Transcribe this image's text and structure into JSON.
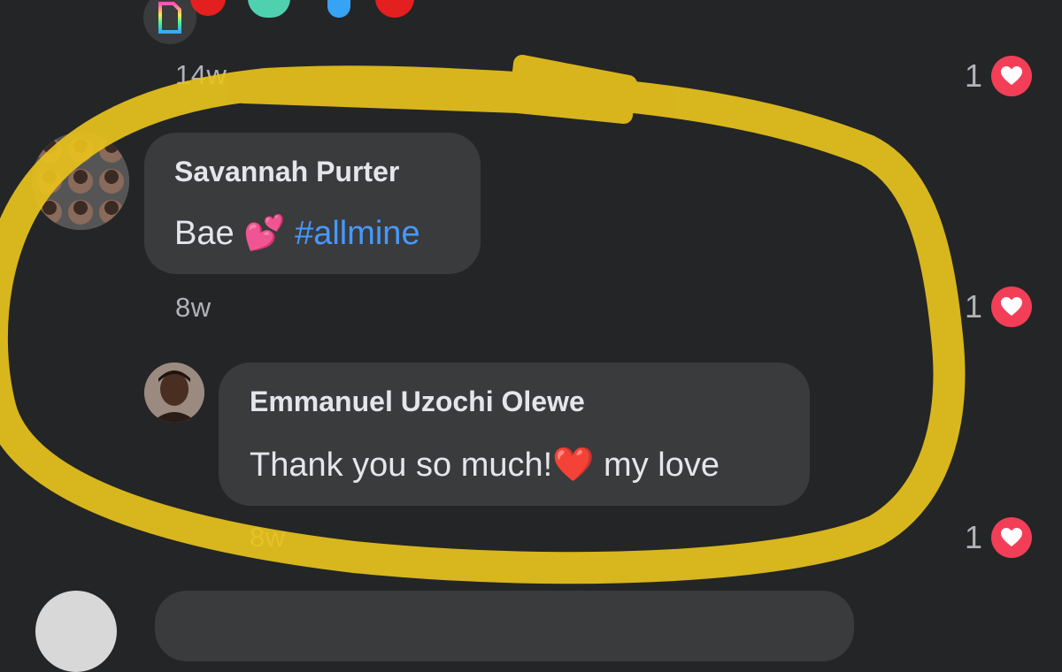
{
  "comments": [
    {
      "id": "gif-comment",
      "timestamp": "14w",
      "likes": "1"
    },
    {
      "id": "savannah",
      "author": "Savannah Purter",
      "text_prefix": "Bae ",
      "emoji": "💕",
      "hashtag": "#allmine",
      "timestamp": "8w",
      "likes": "1"
    },
    {
      "id": "emmanuel",
      "author": "Emmanuel Uzochi Olewe",
      "text_prefix": "Thank you so much!",
      "emoji": "❤️",
      "text_suffix": " my love",
      "timestamp": "8w",
      "likes": "1"
    }
  ],
  "colors": {
    "background": "#242526",
    "bubble": "#3a3b3c",
    "hashtag": "#4599ff",
    "heart_badge": "#f33e58",
    "highlight_marker": "#e8c21c"
  },
  "icons": {
    "gif": "gif-icon",
    "like": "heart-icon"
  }
}
